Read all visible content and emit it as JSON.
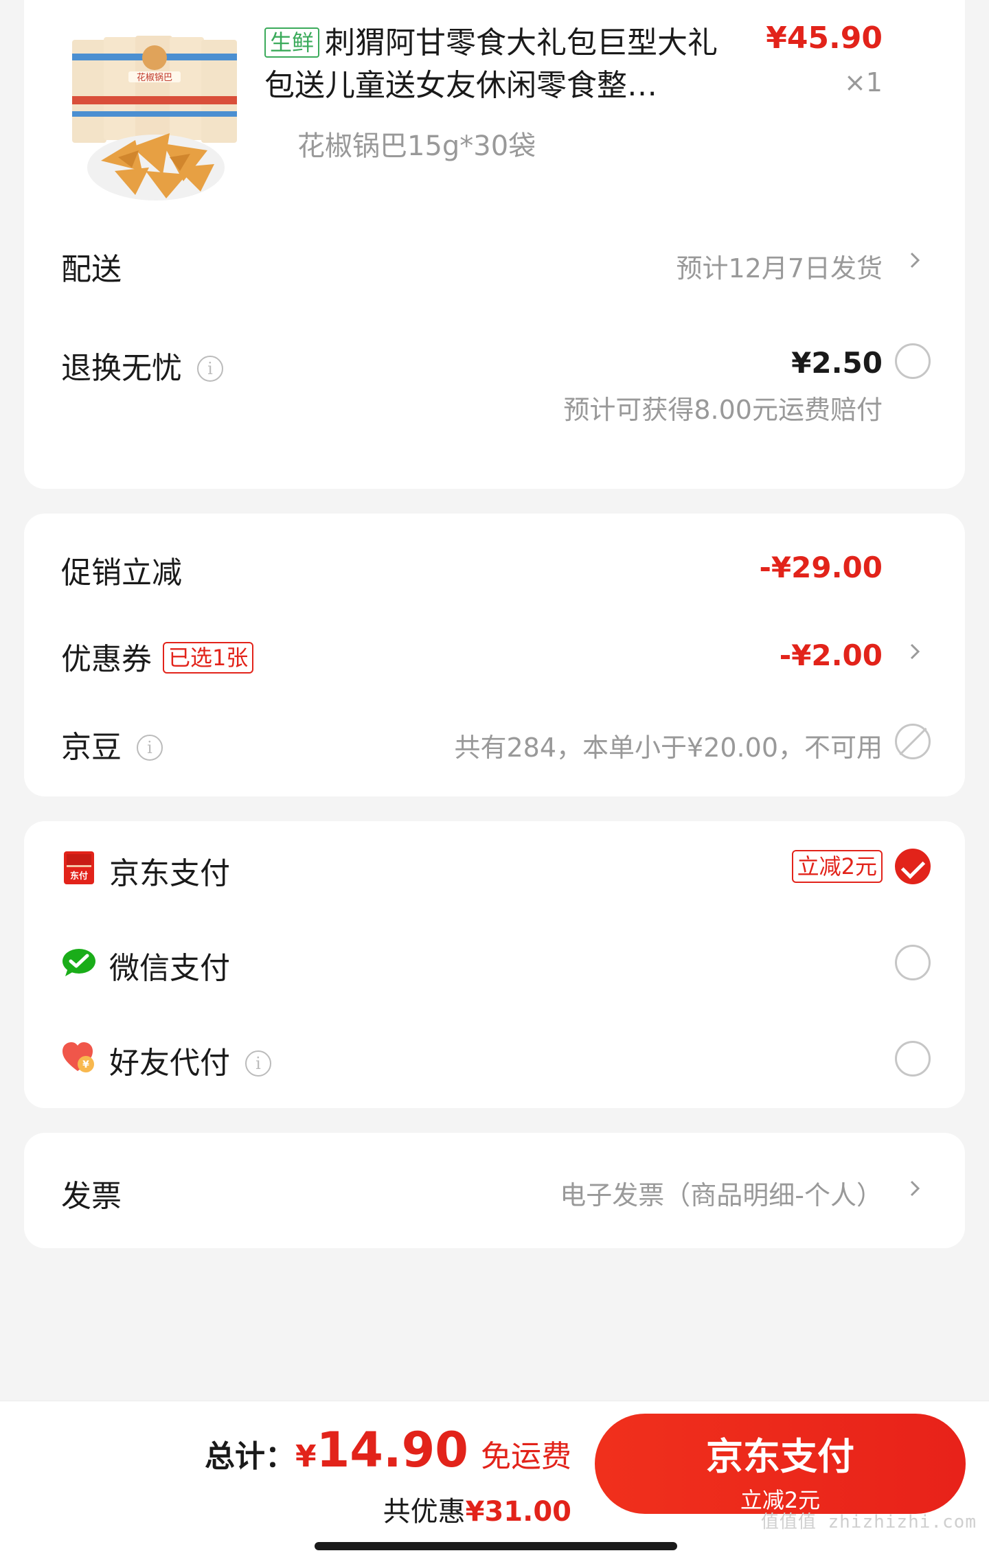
{
  "product": {
    "tag": "生鲜",
    "title": "刺猬阿甘零食大礼包巨型大礼包送儿童送女友休闲零食整…",
    "price": "¥45.90",
    "qty": "×1",
    "spec": "花椒锅巴15g*30袋",
    "thumb_brand": "花椒锅巴"
  },
  "delivery": {
    "label": "配送",
    "value": "预计12月7日发货"
  },
  "return_insurance": {
    "label": "退换无忧",
    "price": "¥2.50",
    "note": "预计可获得8.00元运费赔付",
    "selected": false
  },
  "discounts": {
    "promo": {
      "label": "促销立减",
      "value": "-¥29.00"
    },
    "coupon": {
      "label": "优惠券",
      "badge": "已选1张",
      "value": "-¥2.00"
    },
    "jingdou": {
      "label": "京豆",
      "value": "共有284，本单小于¥20.00，不可用"
    }
  },
  "payment": {
    "jdpay": {
      "label": "京东支付",
      "badge": "立减2元",
      "selected": true,
      "icon_text": "东付"
    },
    "wechat": {
      "label": "微信支付",
      "selected": false
    },
    "friend": {
      "label": "好友代付",
      "selected": false
    }
  },
  "invoice": {
    "label": "发票",
    "value": "电子发票（商品明细-个人）"
  },
  "bottom": {
    "total_label": "总计：",
    "currency": "¥",
    "total": "14.90",
    "free_shipping": "免运费",
    "saved_label": "共优惠",
    "saved_amount": "¥31.00",
    "pay_button": "京东支付",
    "pay_button_sub": "立减2元"
  },
  "watermark": "值值值 zhizhizhi.com",
  "colors": {
    "accent": "#e2231a",
    "green": "#3aaa5a",
    "wechat": "#1aad19",
    "background": "#f4f4f4"
  }
}
